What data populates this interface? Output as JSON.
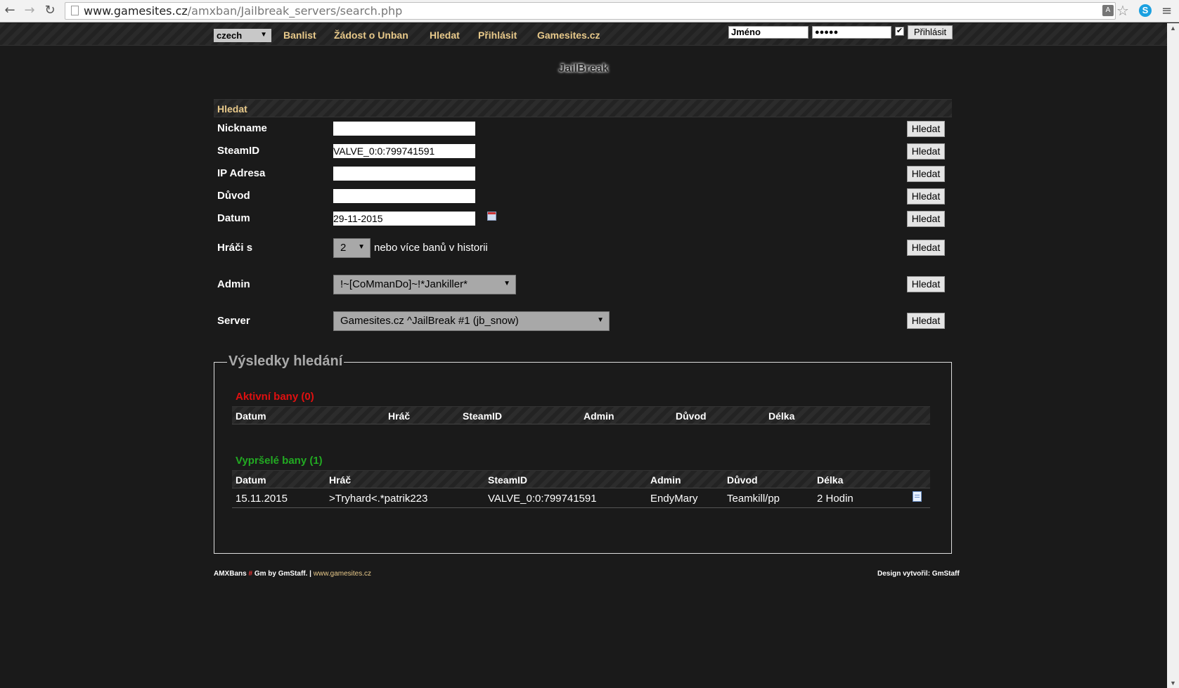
{
  "browser": {
    "url_host": "www.gamesites.cz",
    "url_path": "/amxban/Jailbreak_servers/search.php"
  },
  "topnav": {
    "language": "czech",
    "links": [
      "Banlist",
      "Žádost o Unban",
      "Hledat",
      "Přihlásit",
      "Gamesites.cz"
    ],
    "login_name_value": "Jméno",
    "login_password_value": "●●●●●",
    "remember_checked": true,
    "login_button": "Přihlásit"
  },
  "page_title": "JailBreak",
  "search": {
    "header": "Hledat",
    "button_label": "Hledat",
    "fields": {
      "nickname": {
        "label": "Nickname",
        "value": ""
      },
      "steamid": {
        "label": "SteamID",
        "value": "VALVE_0:0:799741591"
      },
      "ip": {
        "label": "IP Adresa",
        "value": ""
      },
      "reason": {
        "label": "Důvod",
        "value": ""
      },
      "date": {
        "label": "Datum",
        "value": "29-11-2015"
      },
      "players": {
        "label": "Hráči s",
        "value": "2",
        "suffix": "nebo více banů v historii"
      },
      "admin": {
        "label": "Admin",
        "value": "!~[CoMmanDo]~!*Jankiller*"
      },
      "server": {
        "label": "Server",
        "value": "Gamesites.cz ^JailBreak #1 (jb_snow)"
      }
    }
  },
  "results": {
    "legend": "Výsledky hledání",
    "active": {
      "title": "Aktivní bany (0)",
      "color": "#e01010",
      "columns": [
        "Datum",
        "Hráč",
        "SteamID",
        "Admin",
        "Důvod",
        "Délka"
      ]
    },
    "expired": {
      "title": "Vypršelé bany (1)",
      "color": "#22aa22",
      "columns": [
        "Datum",
        "Hráč",
        "SteamID",
        "Admin",
        "Důvod",
        "Délka"
      ],
      "rows": [
        {
          "date": "15.11.2015",
          "player": ">Tryhard<.*patrik223",
          "steamid": "VALVE_0:0:799741591",
          "admin": "EndyMary",
          "reason": "Teamkill/pp",
          "length": "2 Hodin"
        }
      ]
    }
  },
  "footer": {
    "left_app": "AMXBans",
    "left_hash": "#",
    "left_by": "Gm by GmStaff. |",
    "left_site": "www.gamesites.cz",
    "right": "Design vytvořil: GmStaff"
  },
  "colors": {
    "accent": "#e8c98a",
    "background": "#1a1a1a"
  }
}
